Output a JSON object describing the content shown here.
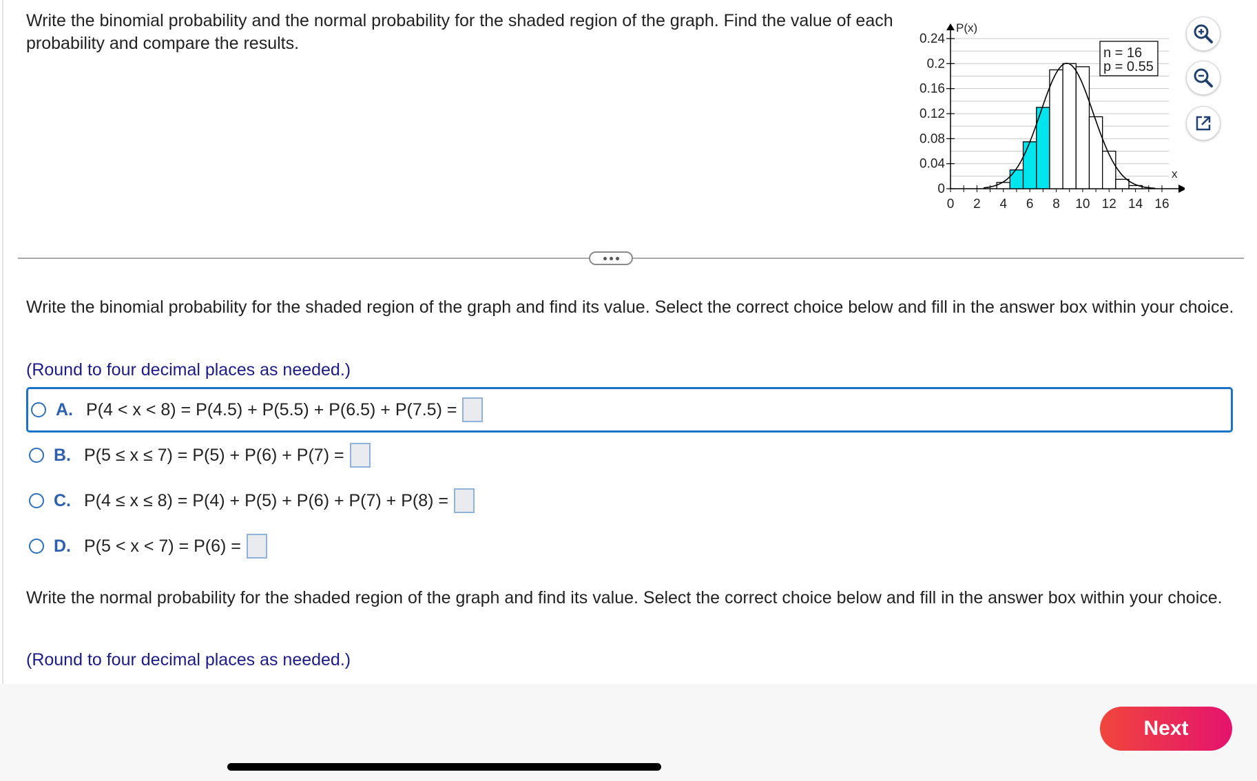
{
  "question": {
    "text": "Write the binomial probability and the normal probability for the shaded region of the graph. Find the value of each probability and compare the results."
  },
  "chart_data": {
    "type": "bar",
    "ylabel": "P(x)",
    "xlabel": "x",
    "legend_n": "n = 16",
    "legend_p": "p = 0.55",
    "y_ticks": [
      "0.24",
      "0.2",
      "0.16",
      "0.12",
      "0.08",
      "0.04",
      "0"
    ],
    "x_ticks": [
      "0",
      "2",
      "4",
      "6",
      "8",
      "10",
      "12",
      "14",
      "16"
    ],
    "ylim": [
      0,
      0.24
    ],
    "xlim": [
      0,
      16
    ],
    "x": [
      4,
      5,
      6,
      7,
      8,
      9,
      10,
      11,
      12,
      13,
      14
    ],
    "values": [
      0.01,
      0.03,
      0.075,
      0.13,
      0.19,
      0.2,
      0.195,
      0.115,
      0.06,
      0.015,
      0.005
    ],
    "shaded": [
      5,
      6,
      7
    ],
    "shade_color": "#00e5ee",
    "curve": "normal"
  },
  "tools": {
    "zoom_in": "zoom-in-icon",
    "zoom_out": "zoom-out-icon",
    "popout": "popout-icon"
  },
  "part1": {
    "prompt": "Write the binomial probability for the shaded region of the graph and find its value. Select the correct choice below and fill in the answer box within your choice.",
    "round_note": "(Round to four decimal places as needed.)",
    "choices": [
      {
        "letter": "A.",
        "formula": "P(4 < x < 8) = P(4.5) + P(5.5) + P(6.5) + P(7.5) ="
      },
      {
        "letter": "B.",
        "formula": "P(5 ≤ x ≤ 7) = P(5) + P(6) + P(7) ="
      },
      {
        "letter": "C.",
        "formula": "P(4 ≤ x ≤ 8) = P(4) + P(5) + P(6) + P(7) + P(8) ="
      },
      {
        "letter": "D.",
        "formula": "P(5 < x < 7) = P(6) ="
      }
    ]
  },
  "part2": {
    "prompt": "Write the normal probability for the shaded region of the graph and find its value. Select the correct choice below and fill in the answer box within your choice.",
    "round_note": "(Round to four decimal places as needed.)"
  },
  "footer": {
    "next_label": "Next"
  },
  "colors": {
    "accent": "#1a73c9",
    "next_start": "#f0463c",
    "next_end": "#e5136e"
  }
}
